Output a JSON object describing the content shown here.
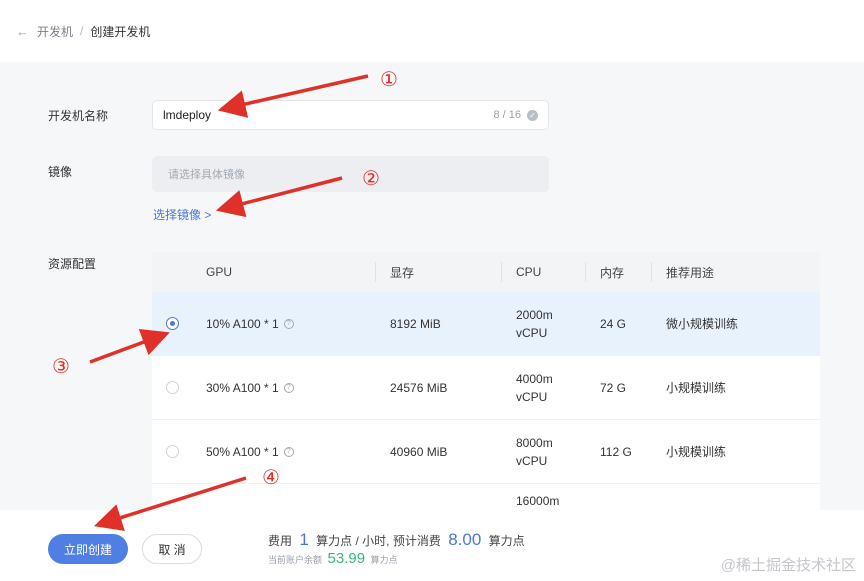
{
  "breadcrumb": {
    "back_icon": "arrow-left-icon",
    "parent": "开发机",
    "separator": "/",
    "current": "创建开发机"
  },
  "form": {
    "name_label": "开发机名称",
    "name_value": "lmdeploy",
    "name_counter": "8 / 16",
    "image_label": "镜像",
    "image_placeholder": "请选择具体镜像",
    "choose_image_link": "选择镜像 >",
    "resource_label": "资源配置"
  },
  "table": {
    "headers": [
      "GPU",
      "显存",
      "CPU",
      "内存",
      "推荐用途"
    ],
    "rows": [
      {
        "selected": true,
        "gpu": "10% A100 * 1",
        "vram": "8192 MiB",
        "cpu_line1": "2000m",
        "cpu_line2": "vCPU",
        "memory": "24 G",
        "usage": "微小规模训练"
      },
      {
        "selected": false,
        "gpu": "30% A100 * 1",
        "vram": "24576 MiB",
        "cpu_line1": "4000m",
        "cpu_line2": "vCPU",
        "memory": "72 G",
        "usage": "小规模训练"
      },
      {
        "selected": false,
        "gpu": "50% A100 * 1",
        "vram": "40960 MiB",
        "cpu_line1": "8000m",
        "cpu_line2": "vCPU",
        "memory": "112 G",
        "usage": "小规模训练"
      },
      {
        "selected": false,
        "gpu": "",
        "vram": "",
        "cpu_line1": "16000m",
        "cpu_line2": "",
        "memory": "",
        "usage": ""
      }
    ]
  },
  "footer": {
    "create_button": "立即创建",
    "cancel_button": "取 消",
    "cost_prefix": "费用",
    "cost_value": "1",
    "cost_unit": "算力点 / 小时, 预计消费",
    "estimate_value": "8.00",
    "estimate_unit": "算力点",
    "balance_prefix": "当前账户余额",
    "balance_value": "53.99",
    "balance_unit": "算力点"
  },
  "annotations": {
    "marker_1": "①",
    "marker_2": "②",
    "marker_3": "③",
    "marker_4": "④"
  },
  "watermark": "@稀土掘金技术社区",
  "colors": {
    "accent": "#4a78d8",
    "primary_button": "#4f7fe3",
    "balance_green": "#3ab57a",
    "annotation_red": "#e0302a",
    "selected_row": "#e8f2fd"
  }
}
